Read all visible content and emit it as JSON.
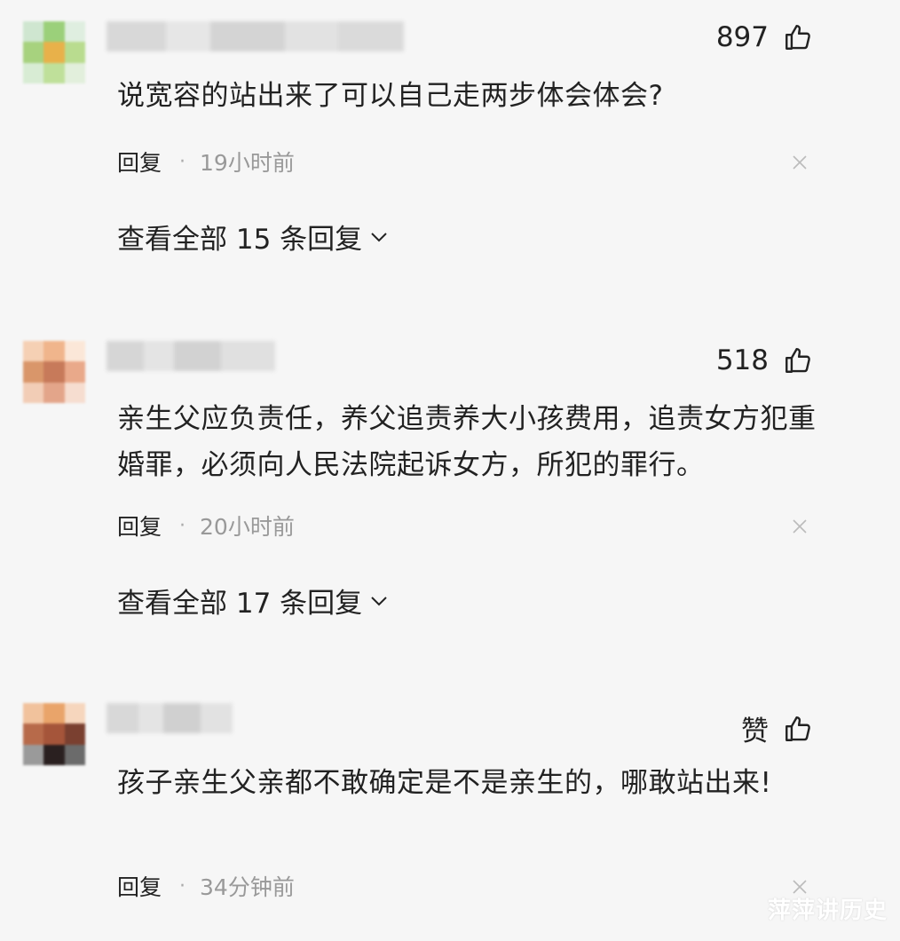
{
  "comments": [
    {
      "likes": "897",
      "text": "说宽容的站出来了可以自己走两步体会体会?",
      "reply_label": "回复",
      "separator": "·",
      "time": "19小时前",
      "view_all": "查看全部 15 条回复",
      "avatar_colors": [
        "#cfe6d0",
        "#9bd07a",
        "#dfeee0",
        "#a7d27e",
        "#e8b14a",
        "#b9dc8f",
        "#d8ecd4",
        "#bfe09a",
        "#e2efdc"
      ]
    },
    {
      "likes": "518",
      "text": "亲生父应负责任，养父追责养大小孩费用，追责女方犯重婚罪，必须向人民法院起诉女方，所犯的罪行。",
      "reply_label": "回复",
      "separator": "·",
      "time": "20小时前",
      "view_all": "查看全部 17 条回复",
      "avatar_colors": [
        "#f5d0b4",
        "#f0b58c",
        "#fbe7d8",
        "#d9966a",
        "#c77a5a",
        "#e9a98a",
        "#f2cdb6",
        "#e3a58a",
        "#f6ddd0"
      ]
    },
    {
      "likes": "赞",
      "text": "孩子亲生父亲都不敢确定是不是亲生的，哪敢站出来!",
      "reply_label": "回复",
      "separator": "·",
      "time": "34分钟前",
      "avatar_colors": [
        "#f1c29c",
        "#e9a46a",
        "#f6d6bd",
        "#b76a4a",
        "#a5553a",
        "#7a4030",
        "#9a9a9a",
        "#2a2020",
        "#6b6b6b"
      ]
    }
  ],
  "watermark": "萍萍讲历史"
}
